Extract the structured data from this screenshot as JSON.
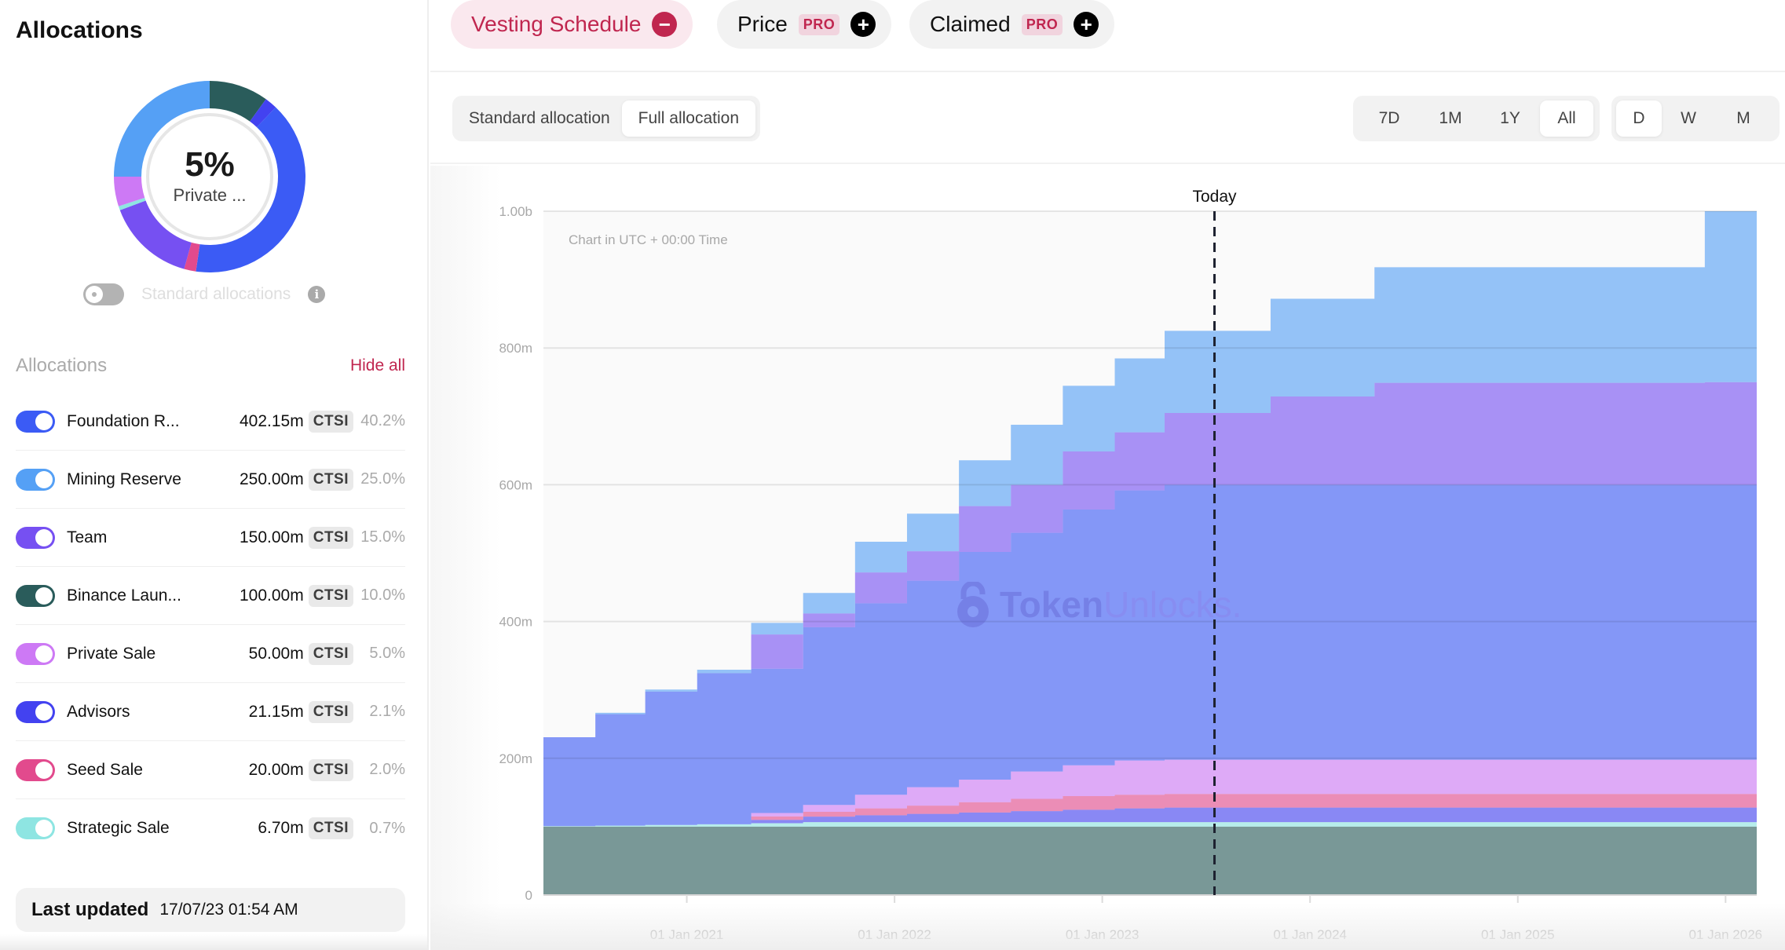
{
  "sidebar": {
    "title": "Allocations",
    "donut": {
      "center_percent": "5%",
      "center_label": "Private ...",
      "segments": [
        {
          "name": "Binance Launchpad",
          "percent": 10.0,
          "color": "#2a5c5b"
        },
        {
          "name": "Advisors",
          "percent": 2.1,
          "color": "#4342f0"
        },
        {
          "name": "Foundation Reserve",
          "percent": 40.2,
          "color": "#3b5bf5"
        },
        {
          "name": "Seed Sale",
          "percent": 2.0,
          "color": "#e24a8d"
        },
        {
          "name": "Team",
          "percent": 15.0,
          "color": "#7650f2"
        },
        {
          "name": "Strategic Sale",
          "percent": 0.7,
          "color": "#8ee5e2"
        },
        {
          "name": "Private Sale",
          "percent": 5.0,
          "color": "#cd79f5"
        },
        {
          "name": "Mining Reserve",
          "percent": 25.0,
          "color": "#55a0f5"
        }
      ]
    },
    "standard_toggle_label": "Standard allocations",
    "list_header": "Allocations",
    "hide_all": "Hide all",
    "items": [
      {
        "name": "Foundation R...",
        "amount": "402.15m",
        "token": "CTSI",
        "percent": "40.2%",
        "color": "#3b5bf5"
      },
      {
        "name": "Mining Reserve",
        "amount": "250.00m",
        "token": "CTSI",
        "percent": "25.0%",
        "color": "#55a0f5"
      },
      {
        "name": "Team",
        "amount": "150.00m",
        "token": "CTSI",
        "percent": "15.0%",
        "color": "#7650f2"
      },
      {
        "name": "Binance Laun...",
        "amount": "100.00m",
        "token": "CTSI",
        "percent": "10.0%",
        "color": "#2a5c5b"
      },
      {
        "name": "Private Sale",
        "amount": "50.00m",
        "token": "CTSI",
        "percent": "5.0%",
        "color": "#cd79f5"
      },
      {
        "name": "Advisors",
        "amount": "21.15m",
        "token": "CTSI",
        "percent": "2.1%",
        "color": "#4342f0"
      },
      {
        "name": "Seed Sale",
        "amount": "20.00m",
        "token": "CTSI",
        "percent": "2.0%",
        "color": "#e24a8d"
      },
      {
        "name": "Strategic Sale",
        "amount": "6.70m",
        "token": "CTSI",
        "percent": "0.7%",
        "color": "#8ee5e2"
      }
    ],
    "last_updated_label": "Last updated",
    "last_updated_value": "17/07/23 01:54 AM"
  },
  "tabs": [
    {
      "label": "Vesting Schedule",
      "active": true,
      "icon": "minus-icon"
    },
    {
      "label": "Price",
      "badge": "PRO",
      "active": false,
      "icon": "plus-icon"
    },
    {
      "label": "Claimed",
      "badge": "PRO",
      "active": false,
      "icon": "plus-icon"
    }
  ],
  "controls": {
    "allocation_mode": {
      "options": [
        "Standard allocation",
        "Full allocation"
      ],
      "selected": "Full allocation"
    },
    "range": {
      "options": [
        "7D",
        "1M",
        "1Y",
        "All"
      ],
      "selected": "All"
    },
    "interval": {
      "options": [
        "D",
        "W",
        "M"
      ],
      "selected": "D"
    }
  },
  "watermark": {
    "part1": "Token",
    "part2": "Unlocks."
  },
  "chart_data": {
    "type": "area",
    "stacked": true,
    "step": true,
    "note": "Chart in UTC + 00:00 Time",
    "today_label": "Today",
    "today_x": 2023.54,
    "xlim": [
      2020.31,
      2026.15
    ],
    "ylim": [
      0,
      1000000000
    ],
    "yticks": [
      {
        "value": 0,
        "label": "0"
      },
      {
        "value": 200000000,
        "label": "200m"
      },
      {
        "value": 400000000,
        "label": "400m"
      },
      {
        "value": 600000000,
        "label": "600m"
      },
      {
        "value": 800000000,
        "label": "800m"
      },
      {
        "value": 1000000000,
        "label": "1.00b"
      }
    ],
    "xticks": [
      {
        "value": 2021.0,
        "label": "01 Jan 2021"
      },
      {
        "value": 2022.0,
        "label": "01 Jan 2022"
      },
      {
        "value": 2023.0,
        "label": "01 Jan 2023"
      },
      {
        "value": 2024.0,
        "label": "01 Jan 2024"
      },
      {
        "value": 2025.0,
        "label": "01 Jan 2025"
      },
      {
        "value": 2026.0,
        "label": "01 Jan 2026"
      }
    ],
    "grid": true,
    "x": [
      2020.31,
      2020.56,
      2020.8,
      2021.05,
      2021.31,
      2021.56,
      2021.81,
      2022.06,
      2022.31,
      2022.56,
      2022.81,
      2023.06,
      2023.3,
      2023.81,
      2024.31,
      2025.9,
      2026.15
    ],
    "series": [
      {
        "name": "Binance Launchpad",
        "color": "#2a5c5b",
        "values": [
          100,
          100,
          100,
          100,
          100,
          100,
          100,
          100,
          100,
          100,
          100,
          100,
          100,
          100,
          100,
          100,
          100
        ]
      },
      {
        "name": "Strategic Sale",
        "color": "#8ee5e2",
        "values": [
          0.8,
          1.5,
          2.5,
          3.5,
          5.0,
          6.7,
          6.7,
          6.7,
          6.7,
          6.7,
          6.7,
          6.7,
          6.7,
          6.7,
          6.7,
          6.7,
          6.7
        ]
      },
      {
        "name": "Advisors",
        "color": "#4342f0",
        "values": [
          0,
          0,
          0,
          0,
          5,
          8,
          10,
          12,
          14,
          16,
          18,
          20,
          21.15,
          21.15,
          21.15,
          21.15,
          21.15
        ]
      },
      {
        "name": "Seed Sale",
        "color": "#e24a8d",
        "values": [
          0,
          0,
          0,
          0,
          5,
          7,
          10,
          12,
          15,
          18,
          20,
          20,
          20,
          20,
          20,
          20,
          20
        ]
      },
      {
        "name": "Private Sale",
        "color": "#cd79f5",
        "values": [
          0,
          0,
          0,
          0,
          5,
          10,
          20,
          27,
          33,
          40,
          45,
          50,
          50,
          50,
          50,
          50,
          50
        ]
      },
      {
        "name": "Foundation Reserve",
        "color": "#3b5bf5",
        "values": [
          130,
          163,
          195,
          221,
          211,
          260,
          280,
          302,
          333,
          349,
          374,
          395,
          402.15,
          402.15,
          402.15,
          402.15,
          402.15
        ]
      },
      {
        "name": "Team",
        "color": "#7650f2",
        "values": [
          0,
          0,
          0,
          0,
          50,
          20,
          45,
          43,
          67,
          70,
          85,
          85,
          105,
          129,
          149,
          150,
          150
        ]
      },
      {
        "name": "Mining Reserve",
        "color": "#55a0f5",
        "values": [
          0,
          2,
          3,
          5,
          17,
          30,
          45,
          55,
          67,
          88,
          96,
          108,
          120,
          143,
          169,
          250,
          250
        ]
      }
    ],
    "units": "millions CTSI"
  }
}
